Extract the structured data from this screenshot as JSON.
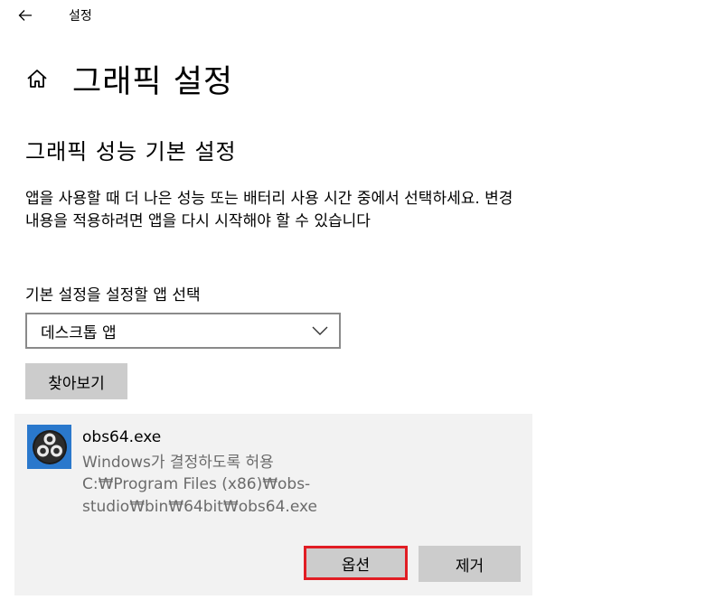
{
  "window": {
    "title": "설정"
  },
  "nav": {
    "back_icon": "back-arrow-icon",
    "home_icon": "home-icon"
  },
  "page": {
    "title": "그래픽 설정"
  },
  "section": {
    "title": "그래픽 성능 기본 설정",
    "description": "앱을 사용할 때 더 나은 성능 또는 배터리 사용 시간 중에서 선택하세요. 변경 내용을 적용하려면 앱을 다시 시작해야 할 수 있습니다"
  },
  "app_picker": {
    "label": "기본 설정을 설정할 앱 선택",
    "selected": "데스크톱 앱",
    "browse_label": "찾아보기"
  },
  "app_entry": {
    "name": "obs64.exe",
    "preference": "Windows가 결정하도록 허용",
    "path": "C:₩Program Files (x86)₩obs-studio₩bin₩64bit₩obs64.exe",
    "options_label": "옵션",
    "remove_label": "제거",
    "icon": "obs-studio-logo-icon"
  },
  "colors": {
    "highlight_border": "#e11d24",
    "button_bg": "#cccccc",
    "card_bg": "#f2f2f2",
    "icon_bg": "#2a78cc"
  }
}
